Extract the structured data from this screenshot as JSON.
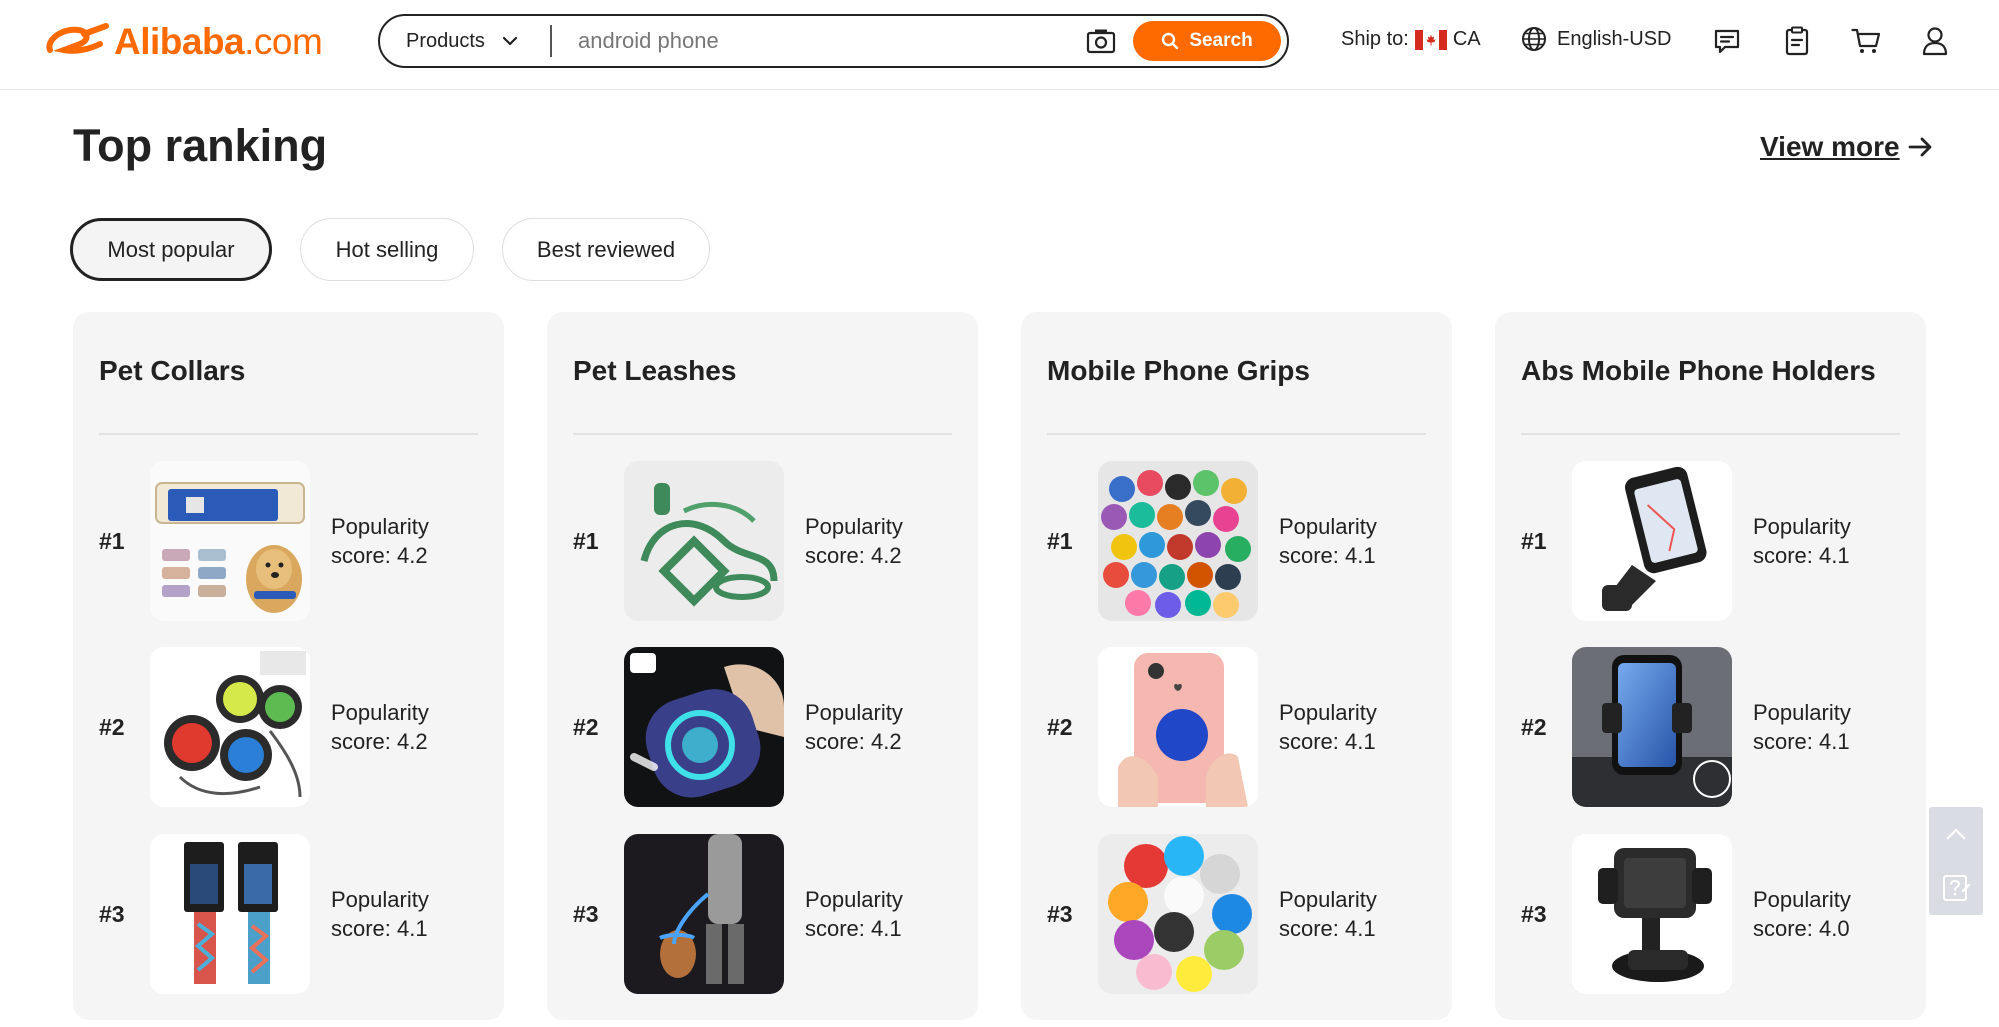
{
  "header": {
    "logo_text": "Alibaba",
    "logo_suffix": ".com",
    "search": {
      "category": "Products",
      "placeholder": "android phone",
      "button_label": "Search"
    },
    "ship_to_label": "Ship to:",
    "ship_to_country": "CA",
    "language": "English-USD"
  },
  "section": {
    "title": "Top ranking",
    "view_more": "View more",
    "tabs": [
      "Most popular",
      "Hot selling",
      "Best reviewed"
    ],
    "active_tab": "Most popular"
  },
  "cards": [
    {
      "title": "Pet Collars",
      "items": [
        {
          "rank": "#1",
          "score_label": "Popularity score: 4.2"
        },
        {
          "rank": "#2",
          "score_label": "Popularity score: 4.2"
        },
        {
          "rank": "#3",
          "score_label": "Popularity score: 4.1"
        }
      ]
    },
    {
      "title": "Pet Leashes",
      "items": [
        {
          "rank": "#1",
          "score_label": "Popularity score: 4.2"
        },
        {
          "rank": "#2",
          "score_label": "Popularity score: 4.2"
        },
        {
          "rank": "#3",
          "score_label": "Popularity score: 4.1"
        }
      ]
    },
    {
      "title": "Mobile Phone Grips",
      "items": [
        {
          "rank": "#1",
          "score_label": "Popularity score: 4.1"
        },
        {
          "rank": "#2",
          "score_label": "Popularity score: 4.1"
        },
        {
          "rank": "#3",
          "score_label": "Popularity score: 4.1"
        }
      ]
    },
    {
      "title": "Abs Mobile Phone Holders",
      "items": [
        {
          "rank": "#1",
          "score_label": "Popularity score: 4.1"
        },
        {
          "rank": "#2",
          "score_label": "Popularity score: 4.1"
        },
        {
          "rank": "#3",
          "score_label": "Popularity score: 4.0"
        }
      ]
    }
  ],
  "colors": {
    "brand": "#ff6a00",
    "card_bg": "#f5f5f5",
    "text": "#222222"
  },
  "icons": [
    "camera-icon",
    "search-icon",
    "globe-icon",
    "message-icon",
    "orders-icon",
    "cart-icon",
    "user-icon",
    "arrow-right-icon",
    "chevron-up-icon",
    "feedback-icon"
  ]
}
